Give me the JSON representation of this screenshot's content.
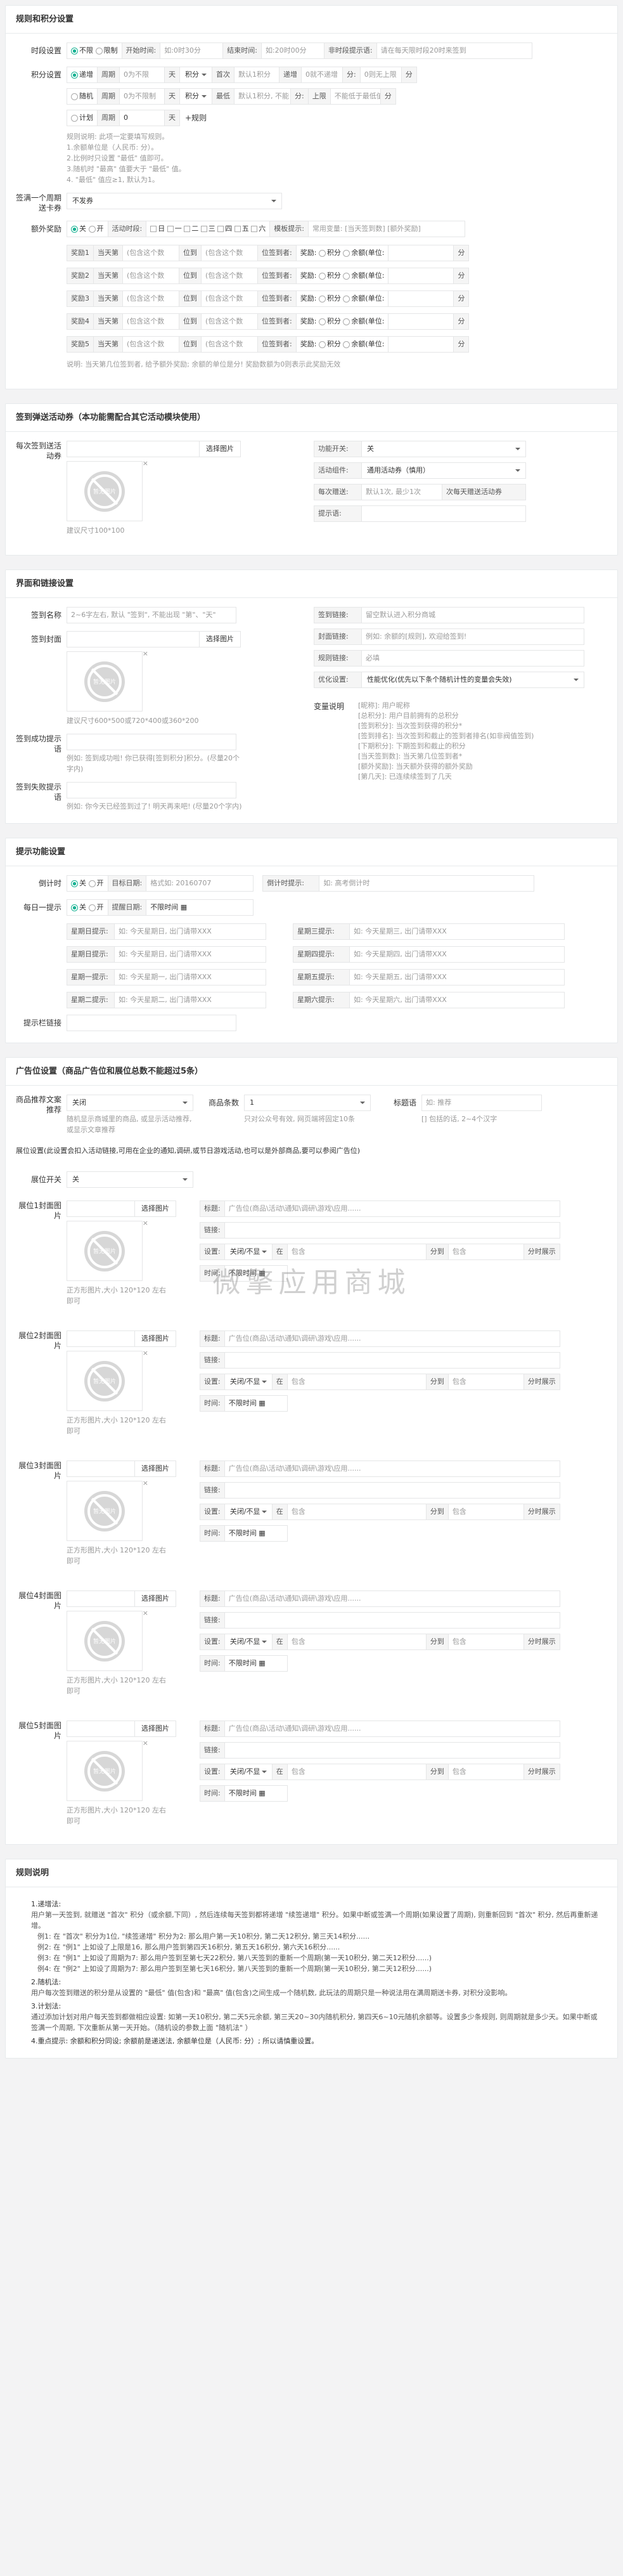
{
  "s1": {
    "title": "规则和积分设置",
    "time_label": "时段设置",
    "time_opt1": "不限",
    "time_opt2": "限制",
    "start_ph": "开始时间:",
    "start_val": "如:0时30分",
    "end_ph": "结束时间:",
    "end_val": "如:20时00分",
    "tip_ph": "非时段提示语:",
    "tip_val": "请在每天限时段20时来签到",
    "score_label": "积分设置",
    "r1": {
      "mode": "递增",
      "period": "周期",
      "days_ph": "0为不限",
      "unit": "天",
      "score": "积分",
      "a": "首次",
      "a_val": "默认1积分",
      "b": "递增",
      "b_val": "0就不递增",
      "c": "分:",
      "c_val": "0则无上限",
      "d": "分"
    },
    "r2": {
      "mode": "随机",
      "period": "周期",
      "days_ph": "0为不限制",
      "unit": "天",
      "score": "积分",
      "a": "最低",
      "a_val": "默认1积分, 不能",
      "b": "分:",
      "b_val": "上限",
      "c": "不能低于最低值",
      "d": "分"
    },
    "r3": {
      "mode": "计划",
      "period": "周期",
      "days": "0",
      "unit": "天",
      "add": "+规则"
    },
    "help": [
      "规则说明: 此项一定要填写规则。",
      "1.余额单位是（人民币: 分）。",
      "2.比例时只设置 \"最低\" 值即可。",
      "3.随机时 \"最高\" 值要大于 \"最低\" 值。",
      "4. \"最低\" 值应≥1, 默认为1。"
    ],
    "cycle_label": "签满一个周期送卡券",
    "cycle_val": "不发券",
    "extra_label": "额外奖励",
    "extra_on": "关",
    "extra_off": "开",
    "extra_time": "活动时段:",
    "days": [
      "日",
      "一",
      "二",
      "三",
      "四",
      "五",
      "六"
    ],
    "mode_label": "模板提示:",
    "mode_val": "常用变量: [当天签到数] [额外奖励]",
    "rewards": [
      {
        "n": "奖励1",
        "p1": "当天第",
        "p2": "(包含这个数",
        "p3": "位到",
        "p4": "(包含这个数",
        "p5": "位签到者:",
        "p6": "奖励",
        "p7": "积分",
        "p8": "余额(单位:",
        "p9": "分"
      },
      {
        "n": "奖励2",
        "p1": "当天第",
        "p2": "(包含这个数",
        "p3": "位到",
        "p4": "(包含这个数",
        "p5": "位签到者:",
        "p6": "奖励",
        "p7": "积分",
        "p8": "余额(单位:",
        "p9": "分"
      },
      {
        "n": "奖励3",
        "p1": "当天第",
        "p2": "(包含这个数",
        "p3": "位到",
        "p4": "(包含这个数",
        "p5": "位签到者:",
        "p6": "奖励",
        "p7": "积分",
        "p8": "余额(单位:",
        "p9": "分"
      },
      {
        "n": "奖励4",
        "p1": "当天第",
        "p2": "(包含这个数",
        "p3": "位到",
        "p4": "(包含这个数",
        "p5": "位签到者:",
        "p6": "奖励",
        "p7": "积分",
        "p8": "余额(单位:",
        "p9": "分"
      },
      {
        "n": "奖励5",
        "p1": "当天第",
        "p2": "(包含这个数",
        "p3": "位到",
        "p4": "(包含这个数",
        "p5": "位签到者:",
        "p6": "奖励",
        "p7": "积分",
        "p8": "余额(单位:",
        "p9": "分"
      }
    ],
    "reward_help": "说明: 当天第几位签到者, 给予额外奖励; 余额的单位是分! 奖励数额为0则表示此奖励无效"
  },
  "s2": {
    "title": "签到弹送活动券（本功能需配合其它活动模块使用）",
    "img_label": "每次签到送活动券",
    "pick": "选择图片",
    "noimg": "暂无图片",
    "x": "×",
    "size": "建议尺寸100*100",
    "f1": "功能开关:",
    "f1v": "关",
    "f2": "活动组件:",
    "f2v": "通用活动券（慎用）",
    "f3": "每次赠送:",
    "f3v": "默认1次, 最少1次",
    "f3b": "次每天赠送活动券",
    "f4": "提示语:"
  },
  "s3": {
    "title": "界面和链接设置",
    "name_label": "签到名称",
    "name_ph": "2~6字左右, 默认 \"签到\", 不能出现 \"第\"、\"天\"",
    "cover_label": "签到封面",
    "pick": "选择图片",
    "noimg": "暂无图片",
    "x": "×",
    "cover_size": "建议尺寸600*500或720*400或360*200",
    "f1": "签到链接:",
    "f1v": "留空默认进入积分商城",
    "f2": "封面链接:",
    "f2v": "例如: 余额的[规则], 欢迎给签到!",
    "f3": "规则链接:",
    "f3v": "必填",
    "f4": "优化设置:",
    "f4v": "性能优化(优先以下条个随机计性的变量会失效)",
    "succ_label": "签到成功提示语",
    "succ_help": "例如: 签到成功啦! 你已获得[签到积分]积分。(尽量20个字内)",
    "fail_label": "签到失败提示语",
    "fail_help": "例如: 你今天已经签到过了! 明天再来吧! (尽量20个字内)",
    "var_title": "变量说明",
    "vars": [
      "[昵称]: 用户昵称",
      "[总积分]: 用户目前拥有的总积分",
      "[签到积分]: 当次签到获得的积分*",
      "[签到排名]: 当次签到和截止的签到者排名(如非阀值签到)",
      "[下期积分]: 下期签到和截止的积分",
      "[当天签到数]: 当天第几位签到者*",
      "[额外奖励]: 当天额外获得的额外奖励",
      "[第几天]: 已连续续签到了几天"
    ]
  },
  "s4": {
    "title": "提示功能设置",
    "dl_label": "倒计时",
    "dl_on": "关",
    "dl_off": "开",
    "dl_date": "目标日期:",
    "dl_date_val": "格式如: 20160707",
    "dl_tip": "倒计时提示:",
    "dl_tip_val": "如: 高考倒计时",
    "daily_label": "每日一提示",
    "daily_on": "关",
    "daily_off": "开",
    "daily_date": "提醒日期:",
    "daily_date_val": "不限时间",
    "days": [
      {
        "l": "星期日提示:",
        "v": "如: 今天星期日, 出门请带XXX"
      },
      {
        "l": "星期三提示:",
        "v": "如: 今天星期三, 出门请带XXX"
      },
      {
        "l": "星期日提示:",
        "v": "如: 今天星期日, 出门请带XXX"
      },
      {
        "l": "星期四提示:",
        "v": "如: 今天星期四, 出门请带XXX"
      },
      {
        "l": "星期一提示:",
        "v": "如: 今天星期一, 出门请带XXX"
      },
      {
        "l": "星期五提示:",
        "v": "如: 今天星期五, 出门请带XXX"
      },
      {
        "l": "星期二提示:",
        "v": "如: 今天星期二, 出门请带XXX"
      },
      {
        "l": "星期六提示:",
        "v": "如: 今天星期六, 出门请带XXX"
      }
    ],
    "link_label": "提示栏链接"
  },
  "watermark": "微擎应用商城",
  "s5": {
    "title": "广告位设置（商品广告位和展位总数不能超过5条）",
    "rec_label": "商品推荐文案推荐",
    "rec_val": "关闭",
    "rec_help": "随机显示商城里的商品, 或显示活动推荐, 或显示文章推荐",
    "cnt_label": "商品条数",
    "cnt_val": "1",
    "cnt_help": "只对公众号有效, 网页端将固定10条",
    "title_label": "标题语",
    "title_val": "如: 推荐",
    "title_help": "[] 包括的话, 2~4个汉字",
    "desc": "展位设置(此设置会扣入活动链接,可用在企业的通知,调研,或节日游戏活动,也可以是外部商品,要可以参阅广告位)",
    "switch_label": "展位开关",
    "switch_val": "关",
    "pick": "选择图片",
    "noimg": "暂无图片",
    "x": "×",
    "size": "正方形图片,大小 120*120 左右即可",
    "f_title": "标题:",
    "f_title_val": "广告位(商品\\活动\\通知\\调研\\游戏\\应用......",
    "f_link": "链接:",
    "f_set": "设置:",
    "f_set_val": "关闭/不显",
    "f_in": "在",
    "f_in_val": "包含",
    "f_score": "分到",
    "f_score_val": "包含",
    "f_show": "分时展示",
    "f_time": "时间:",
    "f_time_val": "不限时间",
    "slots": [
      {
        "label": "展位1封面图片"
      },
      {
        "label": "展位2封面图片"
      },
      {
        "label": "展位3封面图片"
      },
      {
        "label": "展位4封面图片"
      },
      {
        "label": "展位5封面图片"
      }
    ]
  },
  "s6": {
    "title": "规则说明",
    "lines": [
      {
        "t": "1.递增法:"
      },
      {
        "t": "用户第一天签到, 就赠送 \"首次\" 积分（或余额,下同）, 然后连续每天签到都将递增 \"续签递增\" 积分。如果中断或签满一个周期(如果设置了周期), 则重新回到 \"首次\" 积分, 然后再重新递增。"
      },
      {
        "t": "例1: 在 \"首次\" 积分为1位, \"续签递增\" 积分为2: 那么用户第一天10积分, 第二天12积分, 第三天14积分......"
      },
      {
        "t": "例2: 在 \"例1\" 上如设了上限是16, 那么用户签到第四天16积分, 第五天16积分, 第六天16积分......"
      },
      {
        "t": "例3: 在 \"例1\" 上如设了周期为7: 那么用户签到至第七天22积分, 第八天签到的重新一个周期(第一天10积分, 第二天12积分......)"
      },
      {
        "t": "例4: 在 \"例2\" 上如设了周期为7: 那么用户签到至第七天16积分, 第八天签到的重新一个周期(第一天10积分, 第二天12积分......)"
      },
      {
        "t": "2.随机法:"
      },
      {
        "t": "用户每次签到赠送的积分是从设置的 \"最低\" 值(包含)和 \"最高\" 值(包含)之间生成一个随机数, 此玩法的周期只是一种说法用在满周期送卡券, 对积分没影响。"
      },
      {
        "t": "3.计划法:"
      },
      {
        "t": "通过添加计划对用户每天签到都做相应设置: 如第一天10积分, 第二天5元余额, 第三天20~30内随机积分, 第四天6~10元随机余额等。设置多少条规则, 则周期就是多少天。如果中断或签满一个周期, 下次重新从第一天开始。（随机设的参数上面 \"随机法\" ）"
      },
      {
        "t": "4.重点提示: 余额和积分同设; 余额前是递送法, 余额单位是（人民币: 分）; 所以请慎重设置。"
      }
    ]
  }
}
